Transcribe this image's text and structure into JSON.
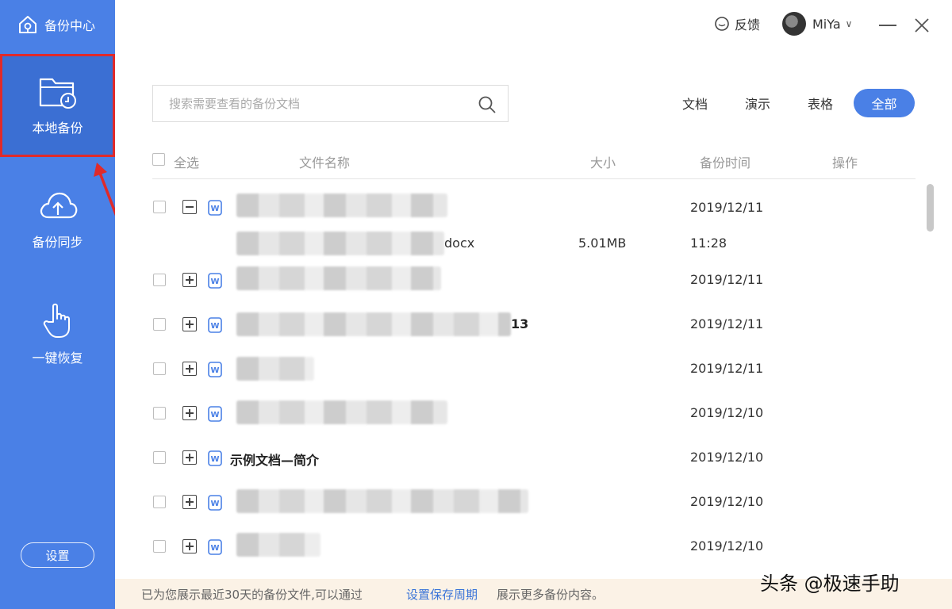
{
  "app": {
    "title": "备份中心",
    "title_icon": "home-shield-icon"
  },
  "sidebar": {
    "items": [
      {
        "label": "本地备份",
        "icon": "folder-clock-icon",
        "active": true
      },
      {
        "label": "备份同步",
        "icon": "cloud-upload-icon",
        "active": false
      },
      {
        "label": "一键恢复",
        "icon": "hand-pointer-icon",
        "active": false
      }
    ],
    "settings_label": "设置"
  },
  "topbar": {
    "feedback_label": "反馈",
    "user_name": "MiYa",
    "user_chevron": "∨"
  },
  "search": {
    "placeholder": "搜索需要查看的备份文档"
  },
  "filters": [
    {
      "label": "文档",
      "active": false
    },
    {
      "label": "演示",
      "active": false
    },
    {
      "label": "表格",
      "active": false
    },
    {
      "label": "全部",
      "active": true
    }
  ],
  "table": {
    "headers": {
      "select_all": "全选",
      "name": "文件名称",
      "size": "大小",
      "time": "备份时间",
      "action": "操作"
    },
    "rows": [
      {
        "name": "",
        "date": "2019/12/11",
        "expanded": true
      },
      {
        "name": "",
        "date": "2019/12/11",
        "expanded": false
      },
      {
        "name": "13",
        "date": "2019/12/11",
        "expanded": false
      },
      {
        "name": "",
        "date": "2019/12/11",
        "expanded": false
      },
      {
        "name": "",
        "date": "2019/12/10",
        "expanded": false
      },
      {
        "name": "示例文档—简介",
        "date": "2019/12/10",
        "expanded": false
      },
      {
        "name": "",
        "date": "2019/12/10",
        "expanded": false
      },
      {
        "name": "",
        "date": "2019/12/10",
        "expanded": false
      }
    ],
    "sub_row": {
      "name_suffix": "docx",
      "size": "5.01MB",
      "time": "11:28"
    }
  },
  "footer": {
    "text_before": "已为您展示最近30天的备份文件,可以通过",
    "link": "设置保存周期",
    "text_after": "展示更多备份内容。"
  },
  "watermark": "头条 @极速手助",
  "colors": {
    "sidebar": "#4a80e6",
    "active_item": "#3b6fd3",
    "highlight_border": "#e02a2a",
    "accent": "#4a80e6",
    "footer_bg": "#fbf2e6",
    "link": "#3a74d8"
  }
}
